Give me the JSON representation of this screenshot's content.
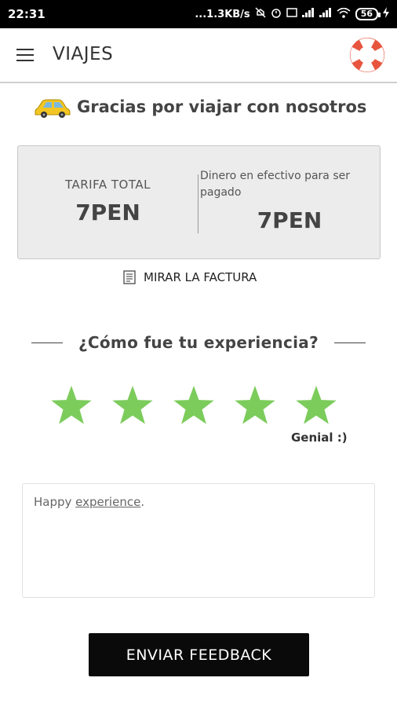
{
  "status_bar": {
    "time": "22:31",
    "net_speed": "...1.3KB/s",
    "battery": "56"
  },
  "app_bar": {
    "title": "VIAJES",
    "menu_icon": "hamburger-menu-icon",
    "help_icon": "lifebuoy-icon"
  },
  "thanks": {
    "icon": "taxi-car-icon",
    "text": "Gracias por viajar con nosotros"
  },
  "fare": {
    "total_label": "TARIFA TOTAL",
    "total_value": "7PEN",
    "cash_label": "Dinero en efectivo para ser pagado",
    "cash_value": "7PEN"
  },
  "invoice": {
    "icon": "receipt-icon",
    "label": "MIRAR LA FACTURA"
  },
  "experience": {
    "title": "¿Cómo fue tu experiencia?",
    "rating": 5,
    "max_rating": 5,
    "star_color": "#7ccc5c",
    "rating_label": "Genial :)"
  },
  "feedback": {
    "text_plain": "Happy ",
    "text_underlined": "experience",
    "text_end": "."
  },
  "submit": {
    "label": "ENVIAR FEEDBACK"
  },
  "colors": {
    "accent_lifebuoy": "#e8553f",
    "button_bg": "#0a0a0a",
    "card_bg": "#ececec"
  }
}
